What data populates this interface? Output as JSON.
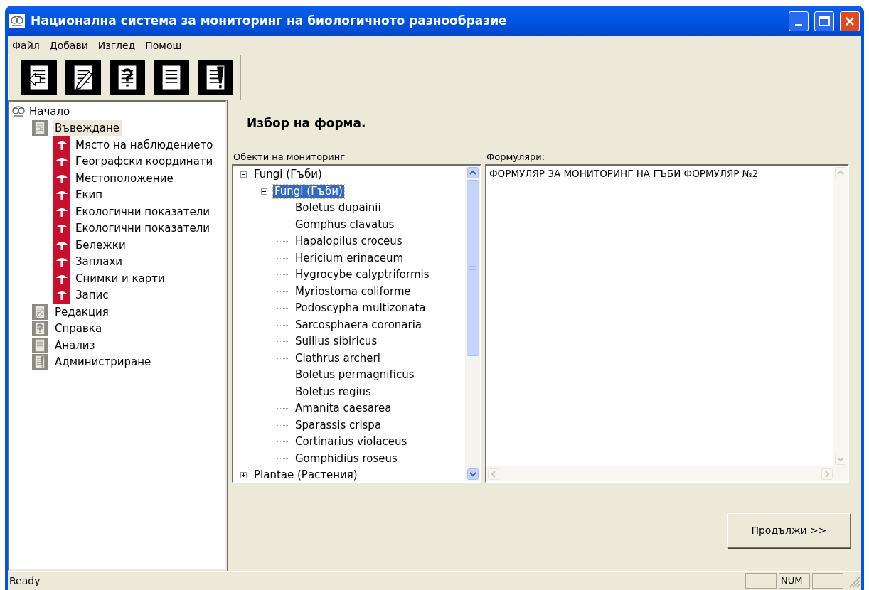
{
  "window": {
    "title": "Национална система за мониторинг на биологичното разнообразие"
  },
  "menu": [
    "Файл",
    "Добави",
    "Изглед",
    "Помощ"
  ],
  "toolbar": [
    {
      "kind": "enter"
    },
    {
      "kind": "edit"
    },
    {
      "kind": "help"
    },
    {
      "kind": "analysis"
    },
    {
      "kind": "admin"
    }
  ],
  "nav": {
    "label": "Начало",
    "children": [
      {
        "label": "Въвеждане",
        "kind": "enter",
        "selected": true,
        "children": [
          {
            "label": "Място на наблюдението"
          },
          {
            "label": "Географски координати"
          },
          {
            "label": "Местоположение"
          },
          {
            "label": "Екип"
          },
          {
            "label": "Екологични показатели"
          },
          {
            "label": "Екологични показатели"
          },
          {
            "label": "Бележки"
          },
          {
            "label": "Заплахи"
          },
          {
            "label": "Снимки и карти"
          },
          {
            "label": "Запис"
          }
        ]
      },
      {
        "label": "Редакция",
        "kind": "edit",
        "selected": false
      },
      {
        "label": "Справка",
        "kind": "help",
        "selected": false
      },
      {
        "label": "Анализ",
        "kind": "analysis",
        "selected": false
      },
      {
        "label": "Администриране",
        "kind": "admin",
        "selected": false
      }
    ]
  },
  "heading": "Избор на форма.",
  "objects": {
    "label": "Обекти на мониторинг",
    "tree": [
      {
        "label": "Fungi (Гъби)",
        "expanded": true,
        "selected": false,
        "children": [
          {
            "label": "Fungi (Гъби)",
            "expanded": true,
            "selected": true,
            "children": [
              {
                "label": "Boletus dupainii",
                "selected": false
              },
              {
                "label": "Gomphus clavatus",
                "selected": false
              },
              {
                "label": "Hapalopilus croceus",
                "selected": false
              },
              {
                "label": "Hericium erinaceum",
                "selected": false
              },
              {
                "label": "Hygrocybe calyptriformis",
                "selected": false
              },
              {
                "label": "Myriostoma coliforme",
                "selected": false
              },
              {
                "label": "Podoscypha multizonata",
                "selected": false
              },
              {
                "label": "Sarcosphaera coronaria",
                "selected": false
              },
              {
                "label": "Suillus sibiricus",
                "selected": false
              },
              {
                "label": "Clathrus archeri",
                "selected": false
              },
              {
                "label": "Boletus permagnificus",
                "selected": false
              },
              {
                "label": "Boletus regius",
                "selected": false
              },
              {
                "label": "Amanita caesarea",
                "selected": false
              },
              {
                "label": "Sparassis crispa",
                "selected": false
              },
              {
                "label": "Cortinarius violaceus",
                "selected": false
              },
              {
                "label": "Gomphidius roseus",
                "selected": false
              }
            ]
          }
        ]
      },
      {
        "label": "Plantae (Растения)",
        "expanded": false,
        "selected": false
      }
    ]
  },
  "forms": {
    "label": "Формуляри:",
    "items": [
      "ФОРМУЛЯР ЗА МОНИТОРИНГ НА ГЪБИ ФОРМУЛЯР №2"
    ]
  },
  "continue_button": "Продължи >>",
  "status_bar": {
    "text": "Ready",
    "indicator": "NUM"
  }
}
